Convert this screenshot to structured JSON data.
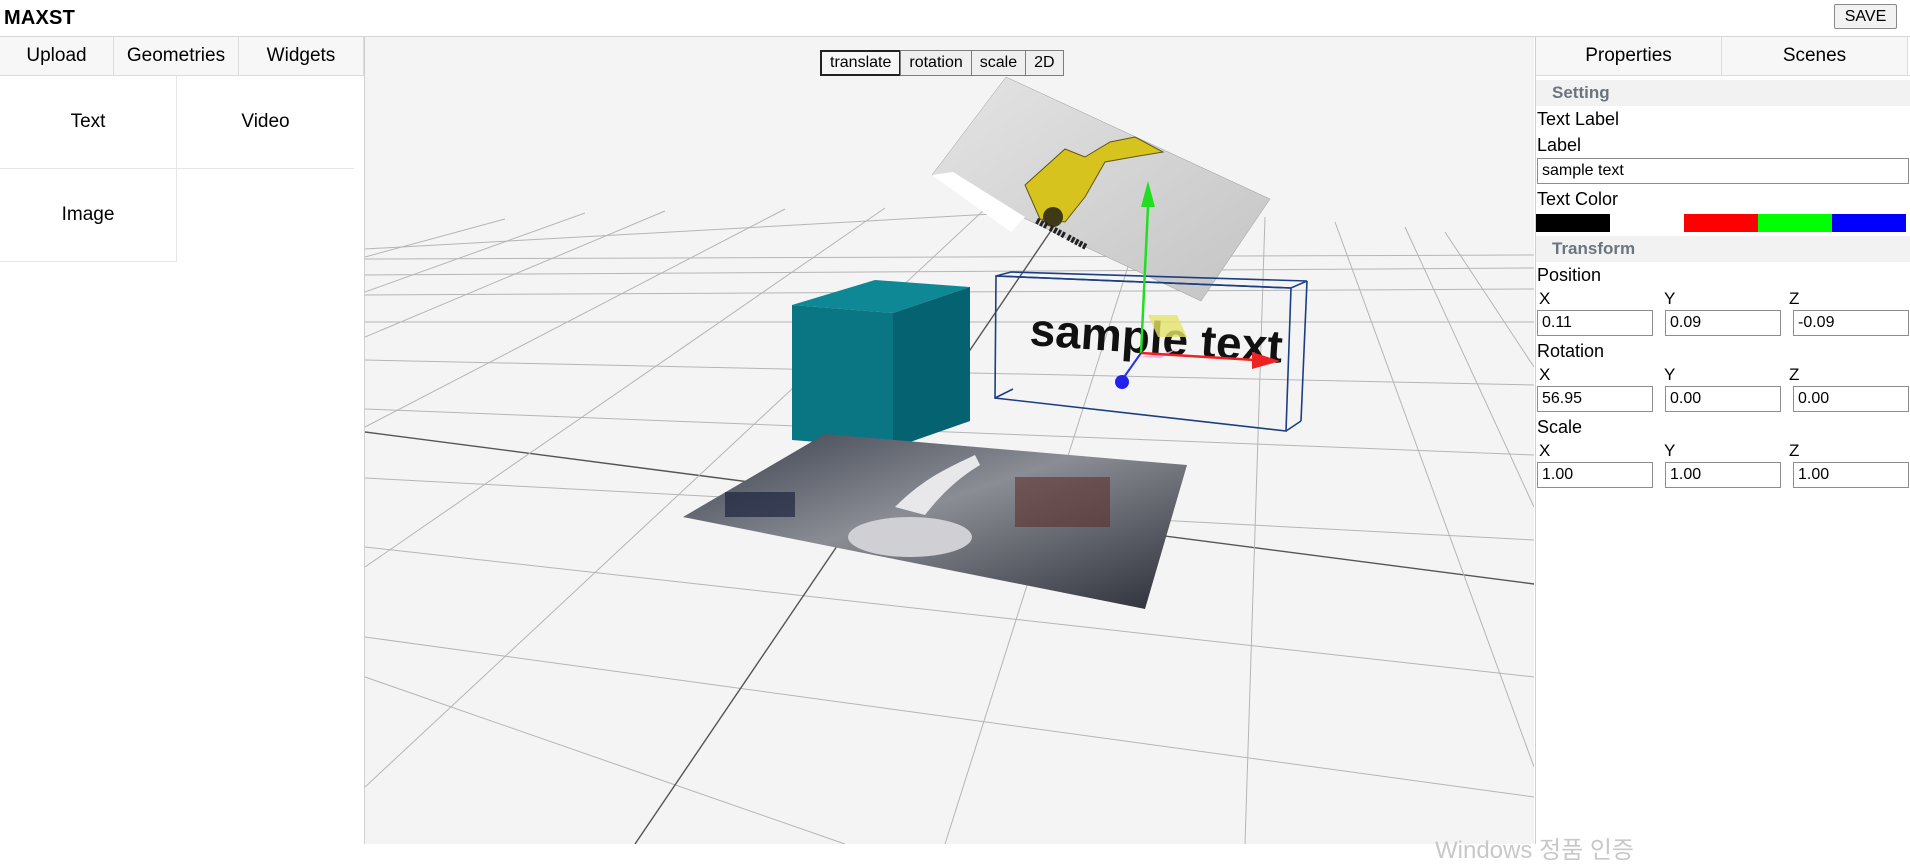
{
  "app": {
    "title": "MAXST",
    "save_label": "SAVE"
  },
  "left_tabs": [
    "Upload",
    "Geometries",
    "Widgets"
  ],
  "widgets": [
    "Text",
    "Video",
    "Image"
  ],
  "viewport": {
    "modes": [
      "translate",
      "rotation",
      "scale",
      "2D"
    ],
    "active_mode": "translate",
    "object_label": "sample text"
  },
  "right_tabs": [
    "Properties",
    "Scenes"
  ],
  "properties": {
    "setting_header": "Setting",
    "text_label_title": "Text Label",
    "label_title": "Label",
    "label_value": "sample text",
    "text_color_title": "Text Color",
    "colors": [
      "#000000",
      "#ffffff",
      "#ff0000",
      "#00ff00",
      "#0000ff"
    ],
    "transform_header": "Transform",
    "axes": [
      "X",
      "Y",
      "Z"
    ],
    "position_title": "Position",
    "position": [
      "0.11",
      "0.09",
      "-0.09"
    ],
    "rotation_title": "Rotation",
    "rotation": [
      "56.95",
      "0.00",
      "0.00"
    ],
    "scale_title": "Scale",
    "scale": [
      "1.00",
      "1.00",
      "1.00"
    ]
  },
  "watermark": "Windows 정품 인증"
}
